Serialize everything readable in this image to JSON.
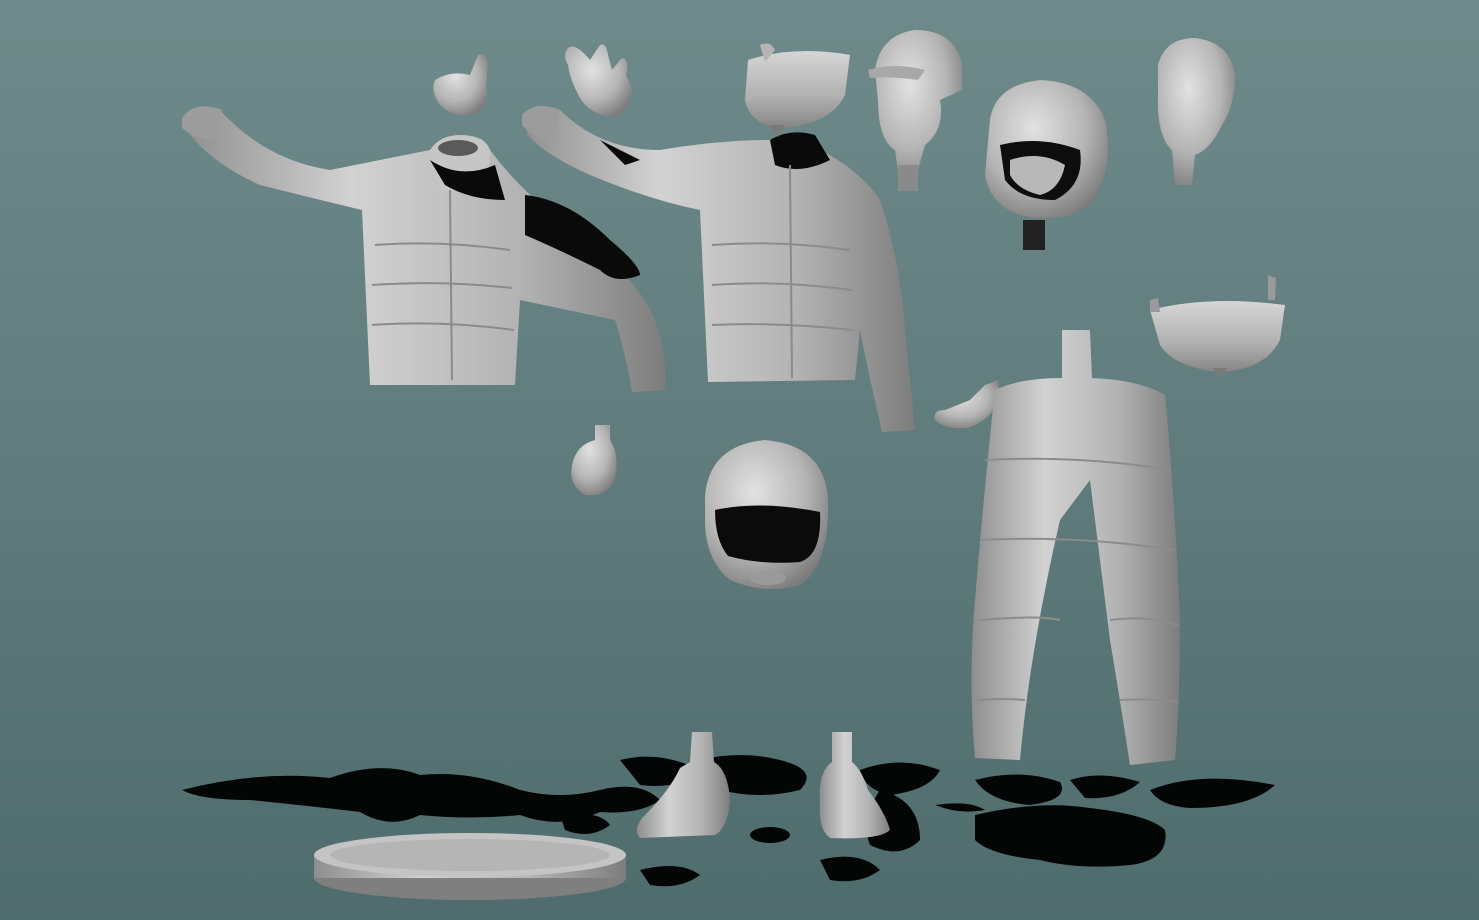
{
  "scene": {
    "description_name": "racing-driver-figure-kit-parts",
    "background_color": "#5f7b7c",
    "material_color": "#b9b9b9",
    "shadow_color": "#000000"
  },
  "parts": [
    {
      "id": "jacket-left",
      "kind": "torso-jacket"
    },
    {
      "id": "jacket-right",
      "kind": "torso-jacket"
    },
    {
      "id": "pants",
      "kind": "trousers"
    },
    {
      "id": "helmet-open",
      "kind": "helmet"
    },
    {
      "id": "helmet-with-face",
      "kind": "helmet"
    },
    {
      "id": "cap-head",
      "kind": "head"
    },
    {
      "id": "bare-head",
      "kind": "head"
    },
    {
      "id": "visor-top",
      "kind": "visor"
    },
    {
      "id": "visor-right",
      "kind": "visor"
    },
    {
      "id": "hand-thumbs-up",
      "kind": "hand"
    },
    {
      "id": "hand-open",
      "kind": "hand"
    },
    {
      "id": "hand-fist",
      "kind": "hand"
    },
    {
      "id": "hand-relaxed",
      "kind": "hand"
    },
    {
      "id": "boot-left",
      "kind": "boot"
    },
    {
      "id": "boot-right",
      "kind": "boot"
    },
    {
      "id": "display-base",
      "kind": "base"
    }
  ]
}
